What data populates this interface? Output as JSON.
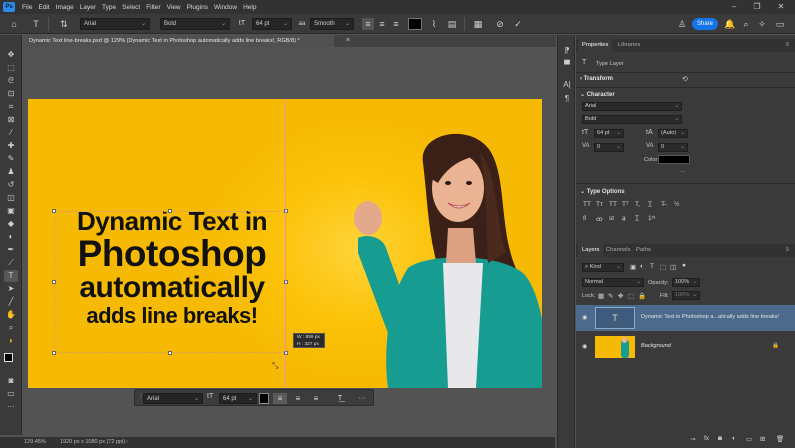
{
  "menu": {
    "logo": "Ps",
    "items": [
      "File",
      "Edit",
      "Image",
      "Layer",
      "Type",
      "Select",
      "Filter",
      "View",
      "Plugins",
      "Window",
      "Help"
    ],
    "minimize": "–",
    "restore": "❐",
    "close": "✕"
  },
  "options": {
    "font_family": "Arial",
    "font_style": "Bold",
    "font_size": "64 pt",
    "anti_alias": "Smooth",
    "share_label": "Share"
  },
  "document": {
    "tab_title": "Dynamic Text line-breaks.psd @ 129% (Dynamic Text in Photoshop automatically adds line breaks!, RGB/8) *",
    "close": "×"
  },
  "canvas": {
    "headline_lines": [
      "Dynamic Text in",
      "Photoshop",
      "automatically",
      "adds line breaks!"
    ],
    "dim_width": "W : 859 px",
    "dim_height": "H : 327 px"
  },
  "context_bar": {
    "font_family": "Arial",
    "font_size": "64 pt",
    "more": "···"
  },
  "status": {
    "zoom": "129.45%",
    "doc_size": "1920 px x 1080 px (72 ppi)"
  },
  "properties": {
    "tabs": [
      "Properties",
      "Libraries"
    ],
    "kind": "Type Layer",
    "transform_label": "Transform",
    "character_label": "Character",
    "font_family": "Arial",
    "font_style": "Bold",
    "font_size": "64 pt",
    "leading": "(Auto)",
    "kerning": "0",
    "tracking": "0",
    "color_label": "Color",
    "more": "···",
    "type_options_label": "Type Options"
  },
  "layers": {
    "tabs": [
      "Layers",
      "Channels",
      "Paths"
    ],
    "filter_kind": "Kind",
    "blend_mode": "Normal",
    "opacity_label": "Opacity:",
    "opacity_value": "100%",
    "lock_label": "Lock:",
    "fill_label": "Fill:",
    "fill_value": "100%",
    "items": [
      {
        "name": "Dynamic Text in Photoshop a...atically adds line breaks!"
      },
      {
        "name": "Background"
      }
    ]
  },
  "colors": {
    "accent": "#1473e6",
    "canvas_yellow": "#f6b904",
    "selected_layer": "#4b6a8c"
  }
}
